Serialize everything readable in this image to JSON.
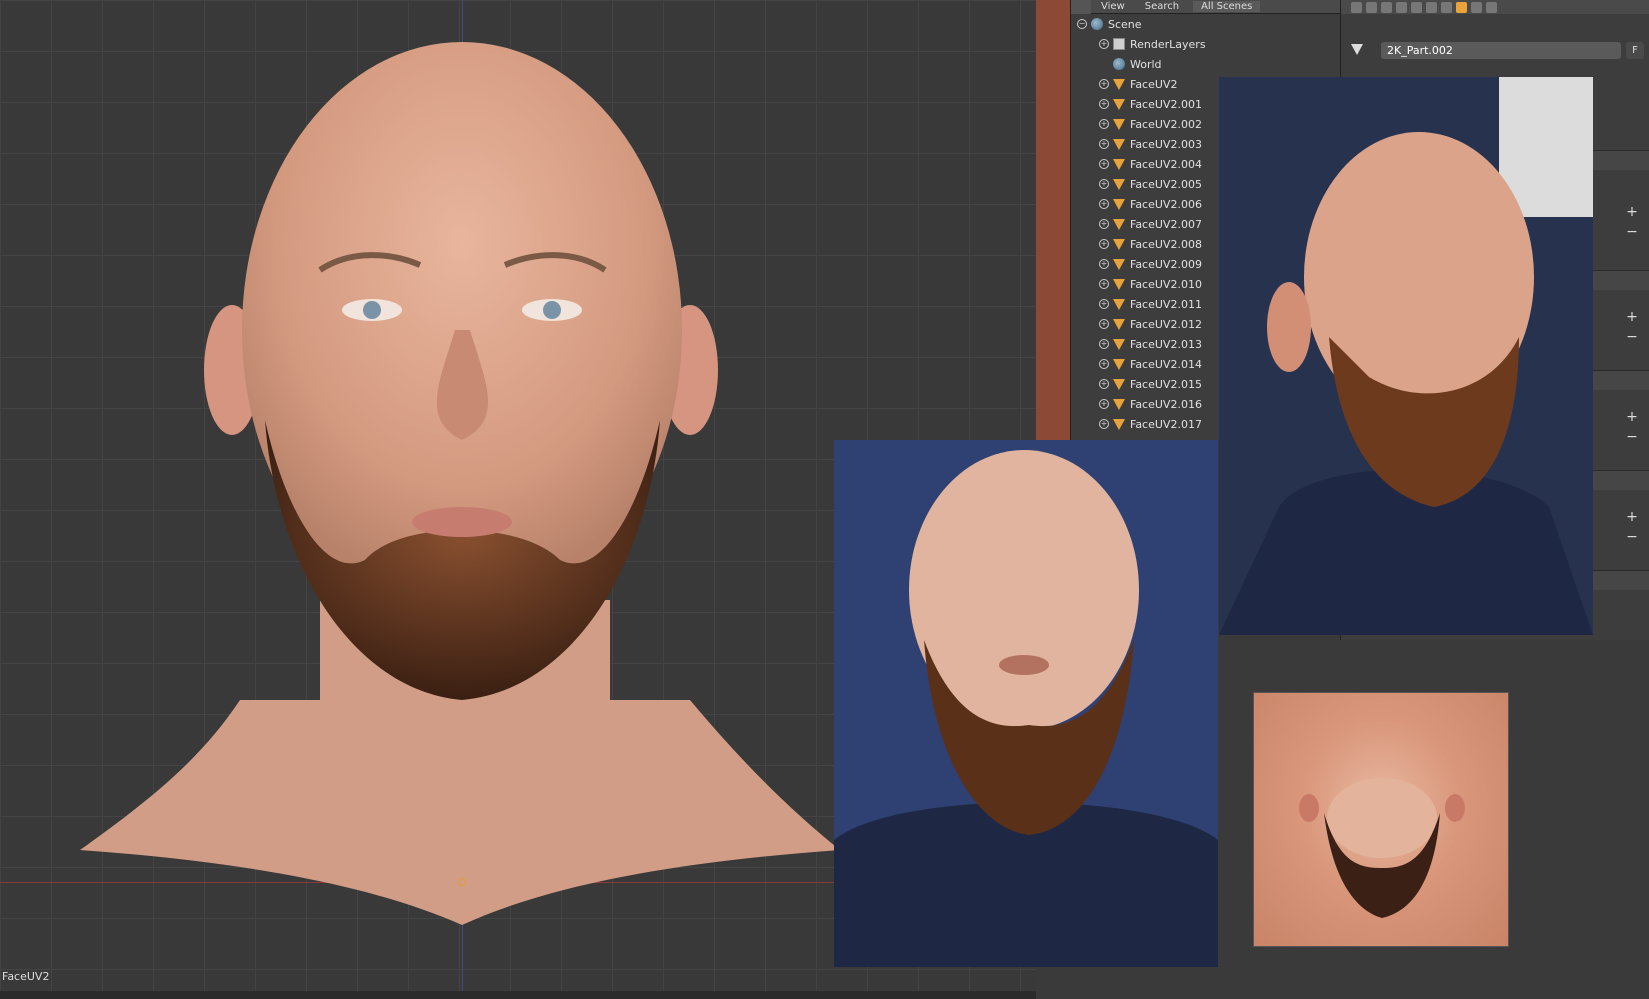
{
  "viewport": {
    "object_label": "FaceUV2"
  },
  "outliner": {
    "header": {
      "view": "View",
      "search": "Search",
      "scenes": "All Scenes"
    },
    "scene": "Scene",
    "render_layers": "RenderLayers",
    "world": "World",
    "objects": [
      "FaceUV2",
      "FaceUV2.001",
      "FaceUV2.002",
      "FaceUV2.003",
      "FaceUV2.004",
      "FaceUV2.005",
      "FaceUV2.006",
      "FaceUV2.007",
      "FaceUV2.008",
      "FaceUV2.009",
      "FaceUV2.010",
      "FaceUV2.011",
      "FaceUV2.012",
      "FaceUV2.013",
      "FaceUV2.014",
      "FaceUV2.015",
      "FaceUV2.016",
      "FaceUV2.017"
    ]
  },
  "properties": {
    "mesh_name": "2K_Part.002",
    "f_label": "F"
  },
  "colors": {
    "object_accent": "#e8a33a",
    "viewport_bg": "#393939",
    "panel_bg": "#3d3d3d"
  }
}
